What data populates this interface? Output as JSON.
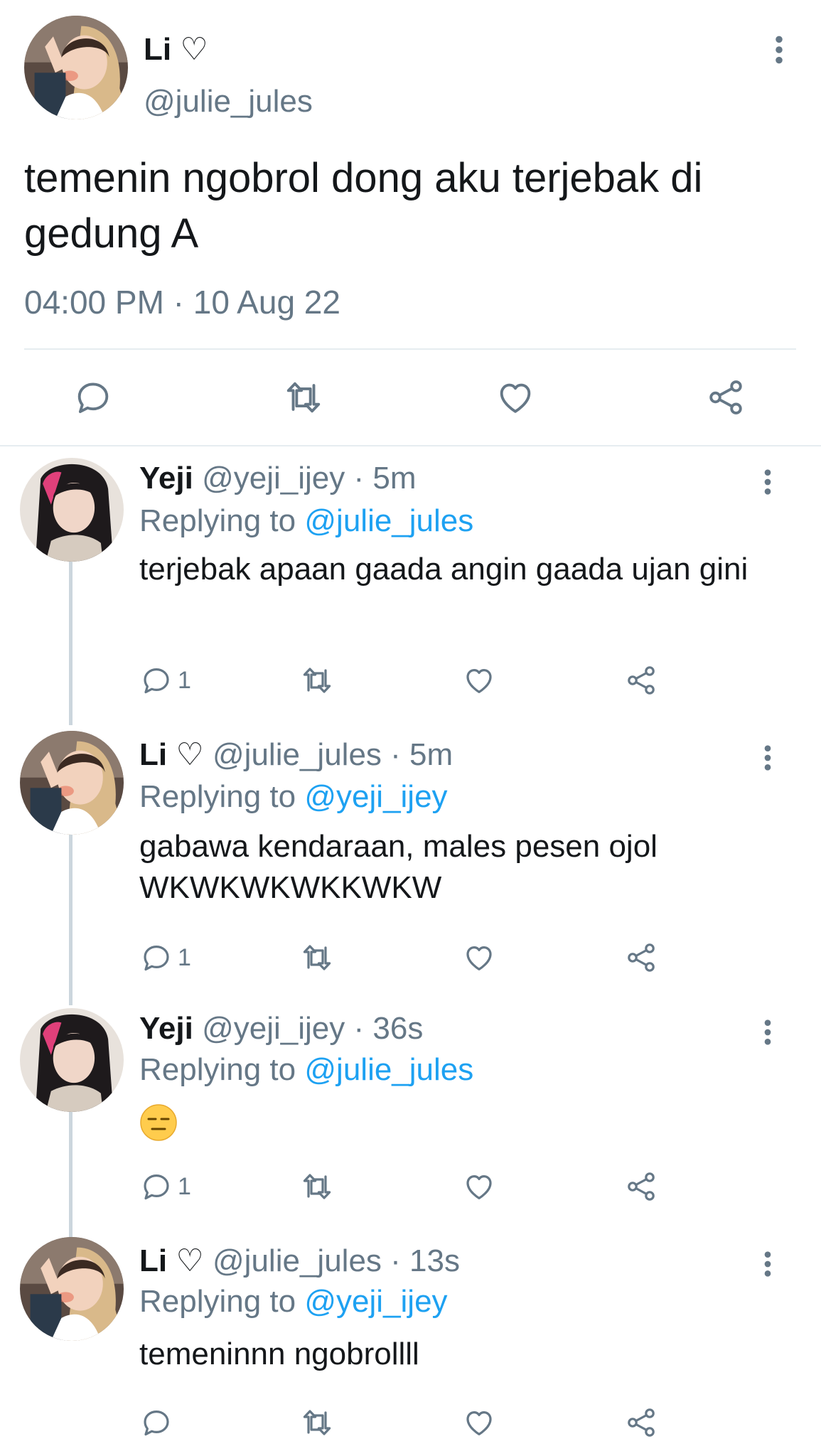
{
  "main_tweet": {
    "name": "Li ♡",
    "handle": "@julie_jules",
    "text": "temenin ngobrol dong aku terjebak di gedung A",
    "timestamp": "04:00 PM · 10 Aug 22",
    "actions": [
      "reply-icon",
      "retweet-icon",
      "like-icon",
      "share-icon"
    ]
  },
  "replies": [
    {
      "name": "Yeji",
      "handle": "@yeji_ijey",
      "time": "· 5m",
      "replying_label": "Replying to",
      "replying_to": "@julie_jules",
      "text": "terjebak apaan gaada angin gaada ujan gini",
      "reply_count": "1"
    },
    {
      "name": "Li ♡",
      "handle": "@julie_jules",
      "time": "· 5m",
      "replying_label": "Replying to",
      "replying_to": "@yeji_ijey",
      "text": "gabawa kendaraan, males pesen ojol WKWKWKWKKWKW",
      "reply_count": "1"
    },
    {
      "name": "Yeji",
      "handle": "@yeji_ijey",
      "time": "· 36s",
      "replying_label": "Replying to",
      "replying_to": "@julie_jules",
      "text": "",
      "emoji": "expressionless-face",
      "reply_count": "1"
    },
    {
      "name": "Li ♡",
      "handle": "@julie_jules",
      "time": "· 13s",
      "replying_label": "Replying to",
      "replying_to": "@yeji_ijey",
      "text": "temeninnn ngobrollll",
      "reply_count": ""
    }
  ],
  "colors": {
    "primary_text": "#14171a",
    "secondary_text": "#657786",
    "link": "#1da1f2",
    "divider": "#e6ecf0",
    "thread_line": "#ccd6dd"
  }
}
